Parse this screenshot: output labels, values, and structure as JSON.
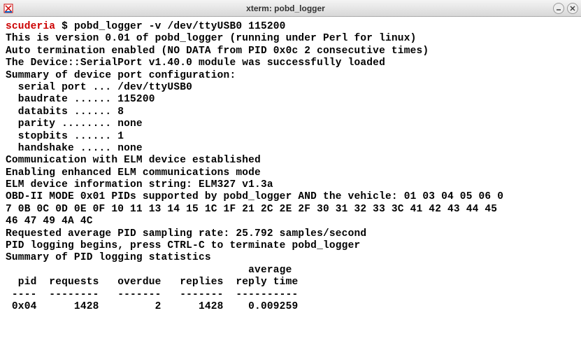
{
  "window": {
    "title": "xterm: pobd_logger"
  },
  "prompt": {
    "host": "scuderia",
    "symbol": "$",
    "command": "pobd_logger -v /dev/ttyUSB0 115200"
  },
  "output": {
    "line01": "This is version 0.01 of pobd_logger (running under Perl for linux)",
    "line02": "Auto termination enabled (NO DATA from PID 0x0c 2 consecutive times)",
    "line03": "The Device::SerialPort v1.40.0 module was successfully loaded",
    "line04": "Summary of device port configuration:",
    "cfg_serial": "  serial port ... /dev/ttyUSB0",
    "cfg_baud": "  baudrate ...... 115200",
    "cfg_databits": "  databits ...... 8",
    "cfg_parity": "  parity ........ none",
    "cfg_stopbits": "  stopbits ...... 1",
    "cfg_handshake": "  handshake ..... none",
    "line05": "Communication with ELM device established",
    "line06": "Enabling enhanced ELM communications mode",
    "line07": "ELM device information string: ELM327 v1.3a",
    "line08": "OBD-II MODE 0x01 PIDs supported by pobd_logger AND the vehicle: 01 03 04 05 06 0",
    "line09": "7 0B 0C 0D 0E 0F 10 11 13 14 15 1C 1F 21 2C 2E 2F 30 31 32 33 3C 41 42 43 44 45",
    "line10": "46 47 49 4A 4C",
    "line11": "Requested average PID sampling rate: 25.792 samples/second",
    "line12": "PID logging begins, press CTRL-C to terminate pobd_logger",
    "line13": "Summary of PID logging statistics",
    "tbl_h1": "                                       average",
    "tbl_h2": "  pid  requests   overdue   replies  reply time",
    "tbl_h3": " ----  --------   -------   -------  ----------",
    "tbl_r1": " 0x04      1428         2      1428    0.009259"
  },
  "table_data": {
    "columns": [
      "pid",
      "requests",
      "overdue",
      "replies",
      "average reply time"
    ],
    "rows": [
      {
        "pid": "0x04",
        "requests": 1428,
        "overdue": 2,
        "replies": 1428,
        "avg_reply_time": 0.009259
      }
    ]
  }
}
